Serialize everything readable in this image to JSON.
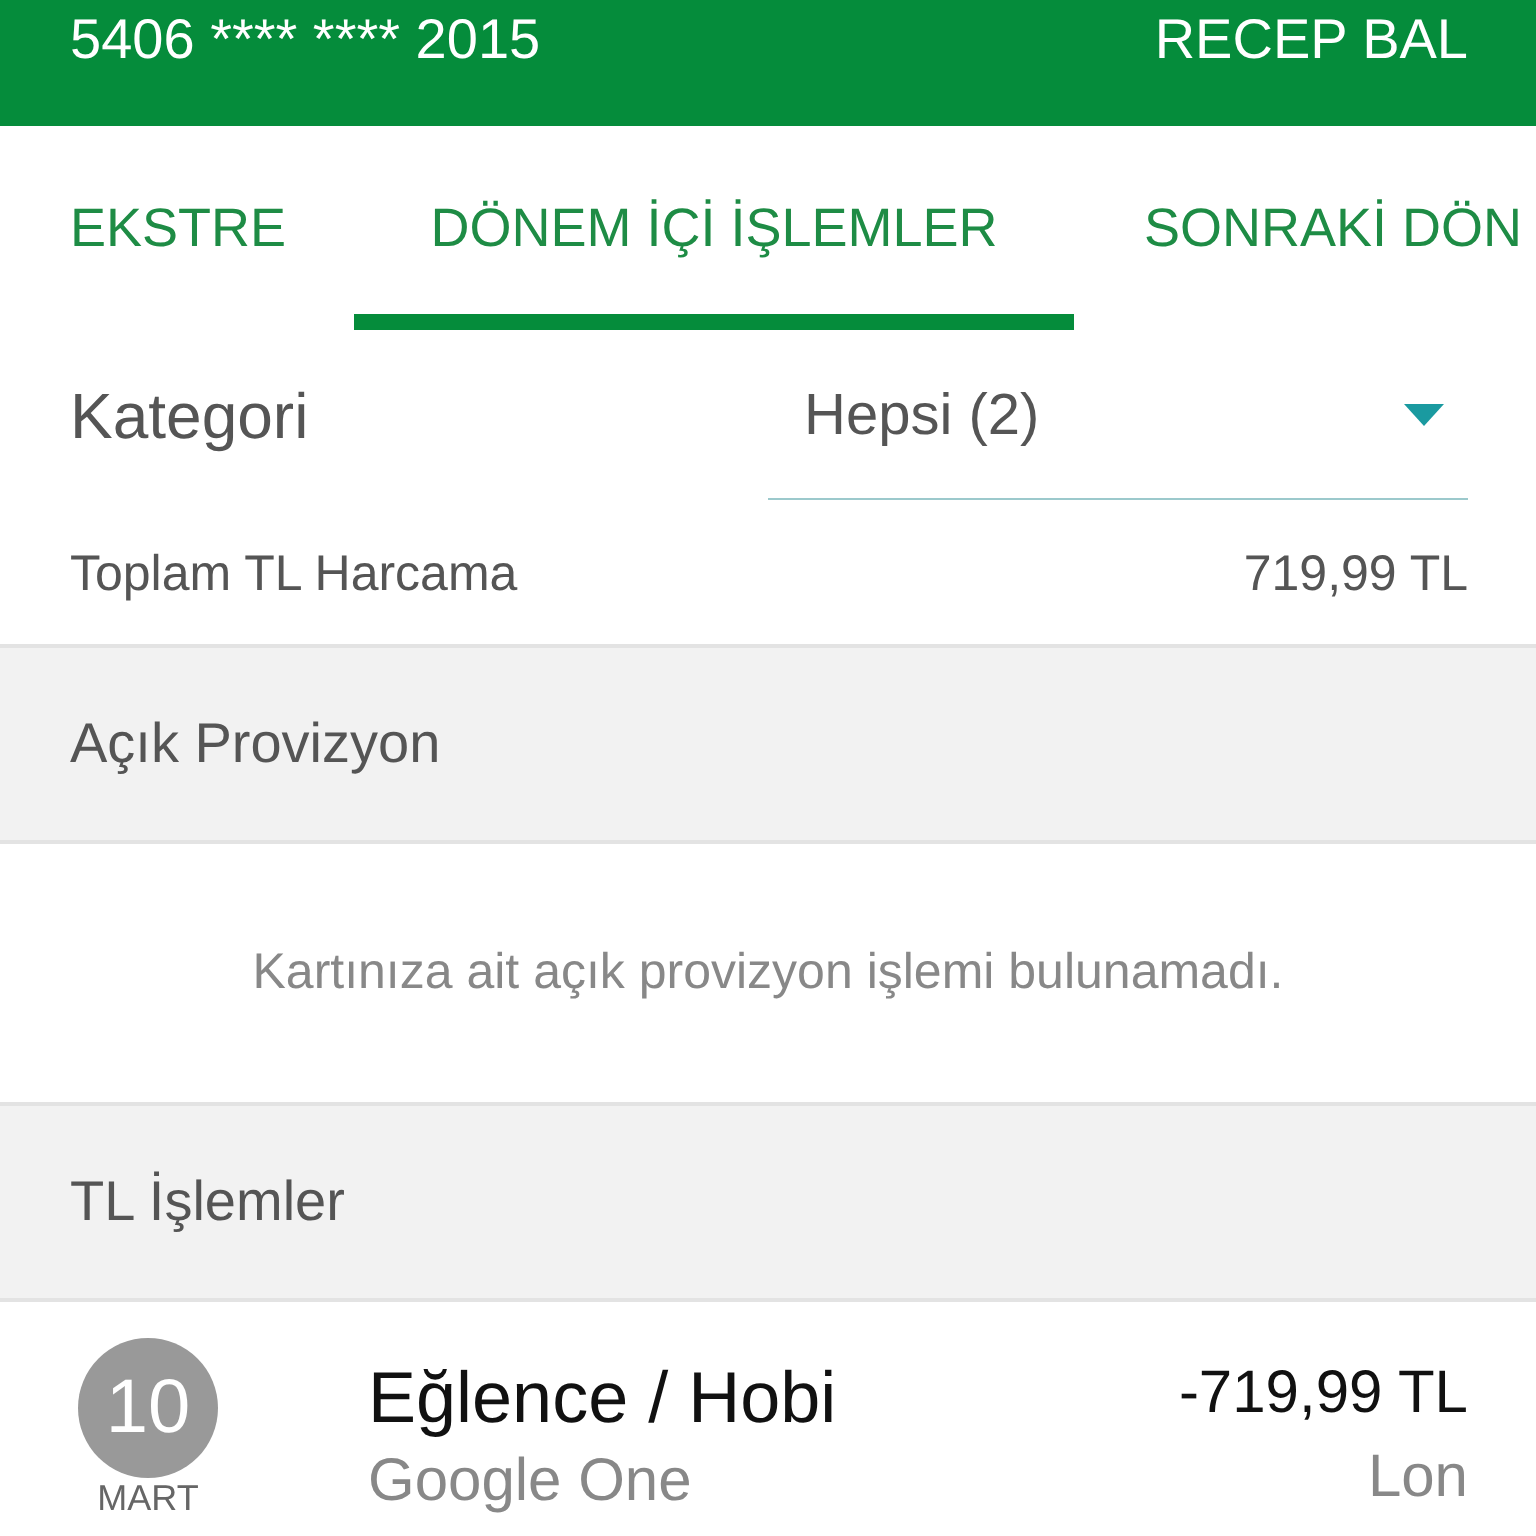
{
  "header": {
    "card_number": "5406 **** **** 2015",
    "holder": "RECEP BAL"
  },
  "tabs": [
    {
      "label": "EKSTRE",
      "selected": false
    },
    {
      "label": "DÖNEM İÇİ İŞLEMLER",
      "selected": true
    },
    {
      "label": "SONRAKİ DÖN",
      "selected": false
    }
  ],
  "filter": {
    "label": "Kategori",
    "value": "Hepsi (2)"
  },
  "total": {
    "label": "Toplam TL Harcama",
    "amount": "719,99 TL"
  },
  "sections": [
    {
      "title": "Açık Provizyon",
      "empty_message": "Kartınıza ait açık provizyon işlemi bulunamadı."
    },
    {
      "title": "TL İşlemler",
      "transactions": [
        {
          "day": "10",
          "month": "MART",
          "category": "Eğlence / Hobi",
          "merchant": "Google One",
          "amount": "-719,99 TL",
          "location": "Lon"
        }
      ]
    }
  ]
}
